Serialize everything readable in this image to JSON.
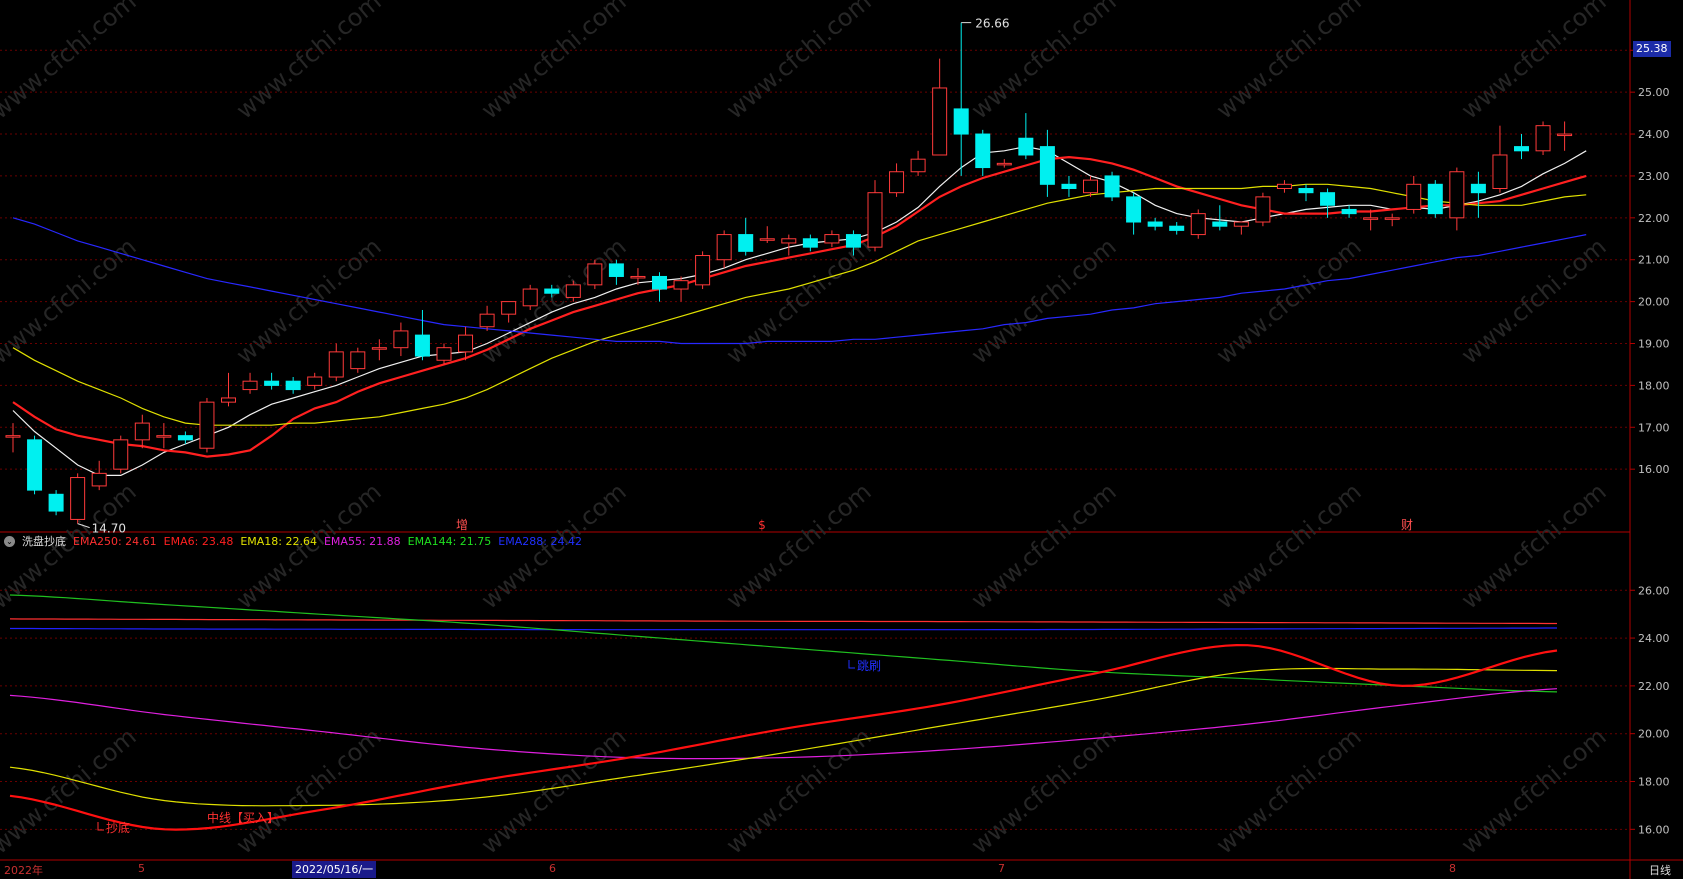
{
  "chart_data": [
    {
      "type": "candlestick",
      "ylim": [
        14.5,
        27.2
      ],
      "y_ticks": [
        "26.00",
        "25.00",
        "24.00",
        "23.00",
        "22.00",
        "21.00",
        "20.00",
        "19.00",
        "18.00",
        "17.00",
        "16.00"
      ],
      "last_price": "25.38",
      "high_annotation": "26.66",
      "low_annotation": "14.70",
      "candles": [
        {
          "o": 16.8,
          "c": 16.8,
          "h": 17.1,
          "l": 16.4
        },
        {
          "o": 16.7,
          "c": 15.5,
          "h": 16.8,
          "l": 15.4
        },
        {
          "o": 15.4,
          "c": 15.0,
          "h": 15.5,
          "l": 14.9
        },
        {
          "o": 14.8,
          "c": 15.8,
          "h": 15.9,
          "l": 14.7
        },
        {
          "o": 15.6,
          "c": 15.9,
          "h": 16.2,
          "l": 15.5
        },
        {
          "o": 16.0,
          "c": 16.7,
          "h": 16.8,
          "l": 15.9
        },
        {
          "o": 16.7,
          "c": 17.1,
          "h": 17.3,
          "l": 16.5
        },
        {
          "o": 16.8,
          "c": 16.8,
          "h": 17.1,
          "l": 16.5
        },
        {
          "o": 16.8,
          "c": 16.7,
          "h": 16.9,
          "l": 16.6
        },
        {
          "o": 16.5,
          "c": 17.6,
          "h": 17.7,
          "l": 16.4
        },
        {
          "o": 17.6,
          "c": 17.7,
          "h": 18.3,
          "l": 17.5
        },
        {
          "o": 17.9,
          "c": 18.1,
          "h": 18.3,
          "l": 17.8
        },
        {
          "o": 18.1,
          "c": 18.0,
          "h": 18.3,
          "l": 17.9
        },
        {
          "o": 18.1,
          "c": 17.9,
          "h": 18.2,
          "l": 17.8
        },
        {
          "o": 18.0,
          "c": 18.2,
          "h": 18.3,
          "l": 17.9
        },
        {
          "o": 18.2,
          "c": 18.8,
          "h": 19.0,
          "l": 18.1
        },
        {
          "o": 18.4,
          "c": 18.8,
          "h": 18.9,
          "l": 18.3
        },
        {
          "o": 18.9,
          "c": 18.9,
          "h": 19.1,
          "l": 18.6
        },
        {
          "o": 18.9,
          "c": 19.3,
          "h": 19.5,
          "l": 18.7
        },
        {
          "o": 19.2,
          "c": 18.7,
          "h": 19.8,
          "l": 18.6
        },
        {
          "o": 18.6,
          "c": 18.9,
          "h": 19.0,
          "l": 18.5
        },
        {
          "o": 18.8,
          "c": 19.2,
          "h": 19.4,
          "l": 18.6
        },
        {
          "o": 19.4,
          "c": 19.7,
          "h": 19.9,
          "l": 19.3
        },
        {
          "o": 19.7,
          "c": 20.0,
          "h": 20.0,
          "l": 19.5
        },
        {
          "o": 19.9,
          "c": 20.3,
          "h": 20.4,
          "l": 19.8
        },
        {
          "o": 20.3,
          "c": 20.2,
          "h": 20.4,
          "l": 20.1
        },
        {
          "o": 20.1,
          "c": 20.4,
          "h": 20.5,
          "l": 20.0
        },
        {
          "o": 20.4,
          "c": 20.9,
          "h": 21.0,
          "l": 20.3
        },
        {
          "o": 20.9,
          "c": 20.6,
          "h": 21.0,
          "l": 20.4
        },
        {
          "o": 20.6,
          "c": 20.6,
          "h": 20.8,
          "l": 20.4
        },
        {
          "o": 20.6,
          "c": 20.3,
          "h": 20.7,
          "l": 20.0
        },
        {
          "o": 20.3,
          "c": 20.5,
          "h": 20.6,
          "l": 20.0
        },
        {
          "o": 20.4,
          "c": 21.1,
          "h": 21.2,
          "l": 20.3
        },
        {
          "o": 21.0,
          "c": 21.6,
          "h": 21.7,
          "l": 20.8
        },
        {
          "o": 21.6,
          "c": 21.2,
          "h": 22.0,
          "l": 21.1
        },
        {
          "o": 21.5,
          "c": 21.5,
          "h": 21.8,
          "l": 21.4
        },
        {
          "o": 21.4,
          "c": 21.5,
          "h": 21.6,
          "l": 21.1
        },
        {
          "o": 21.5,
          "c": 21.3,
          "h": 21.6,
          "l": 21.2
        },
        {
          "o": 21.4,
          "c": 21.6,
          "h": 21.7,
          "l": 21.3
        },
        {
          "o": 21.6,
          "c": 21.3,
          "h": 21.7,
          "l": 21.1
        },
        {
          "o": 21.3,
          "c": 22.6,
          "h": 22.9,
          "l": 21.2
        },
        {
          "o": 22.6,
          "c": 23.1,
          "h": 23.3,
          "l": 22.5
        },
        {
          "o": 23.1,
          "c": 23.4,
          "h": 23.6,
          "l": 23.0
        },
        {
          "o": 23.5,
          "c": 25.1,
          "h": 25.8,
          "l": 23.5
        },
        {
          "o": 24.6,
          "c": 24.0,
          "h": 26.66,
          "l": 23.0
        },
        {
          "o": 24.0,
          "c": 23.2,
          "h": 24.1,
          "l": 23.0
        },
        {
          "o": 23.3,
          "c": 23.3,
          "h": 23.4,
          "l": 23.2
        },
        {
          "o": 23.9,
          "c": 23.5,
          "h": 24.5,
          "l": 23.4
        },
        {
          "o": 23.7,
          "c": 22.8,
          "h": 24.1,
          "l": 22.5
        },
        {
          "o": 22.8,
          "c": 22.7,
          "h": 23.0,
          "l": 22.5
        },
        {
          "o": 22.6,
          "c": 22.9,
          "h": 23.0,
          "l": 22.5
        },
        {
          "o": 23.0,
          "c": 22.5,
          "h": 23.1,
          "l": 22.4
        },
        {
          "o": 22.5,
          "c": 21.9,
          "h": 22.6,
          "l": 21.6
        },
        {
          "o": 21.9,
          "c": 21.8,
          "h": 22.0,
          "l": 21.7
        },
        {
          "o": 21.8,
          "c": 21.7,
          "h": 21.9,
          "l": 21.6
        },
        {
          "o": 21.6,
          "c": 22.1,
          "h": 22.2,
          "l": 21.5
        },
        {
          "o": 21.9,
          "c": 21.8,
          "h": 22.3,
          "l": 21.7
        },
        {
          "o": 21.8,
          "c": 21.9,
          "h": 21.9,
          "l": 21.6
        },
        {
          "o": 21.9,
          "c": 22.5,
          "h": 22.6,
          "l": 21.8
        },
        {
          "o": 22.7,
          "c": 22.8,
          "h": 22.9,
          "l": 22.6
        },
        {
          "o": 22.7,
          "c": 22.6,
          "h": 22.8,
          "l": 22.4
        },
        {
          "o": 22.6,
          "c": 22.3,
          "h": 22.7,
          "l": 22.0
        },
        {
          "o": 22.2,
          "c": 22.1,
          "h": 22.3,
          "l": 22.0
        },
        {
          "o": 22.0,
          "c": 22.0,
          "h": 22.2,
          "l": 21.7
        },
        {
          "o": 22.0,
          "c": 22.0,
          "h": 22.1,
          "l": 21.8
        },
        {
          "o": 22.2,
          "c": 22.8,
          "h": 23.0,
          "l": 22.1
        },
        {
          "o": 22.8,
          "c": 22.1,
          "h": 22.9,
          "l": 22.0
        },
        {
          "o": 22.0,
          "c": 23.1,
          "h": 23.2,
          "l": 21.7
        },
        {
          "o": 22.8,
          "c": 22.6,
          "h": 23.1,
          "l": 22.0
        },
        {
          "o": 22.7,
          "c": 23.5,
          "h": 24.2,
          "l": 22.6
        },
        {
          "o": 23.7,
          "c": 23.6,
          "h": 24.0,
          "l": 23.4
        },
        {
          "o": 23.6,
          "c": 24.2,
          "h": 24.3,
          "l": 23.5
        },
        {
          "o": 24.0,
          "c": 24.0,
          "h": 24.3,
          "l": 23.6
        }
      ],
      "lines": [
        {
          "color": "#f0f0f0",
          "values": [
            17.4,
            16.9,
            16.5,
            16.1,
            15.85,
            15.85,
            16.1,
            16.4,
            16.6,
            16.8,
            17.0,
            17.3,
            17.55,
            17.7,
            17.85,
            18.0,
            18.2,
            18.4,
            18.55,
            18.7,
            18.75,
            18.8,
            19.0,
            19.25,
            19.5,
            19.75,
            19.95,
            20.1,
            20.3,
            20.45,
            20.5,
            20.55,
            20.65,
            20.8,
            21.0,
            21.15,
            21.3,
            21.4,
            21.45,
            21.5,
            21.65,
            21.9,
            22.25,
            22.75,
            23.2,
            23.55,
            23.6,
            23.7,
            23.6,
            23.3,
            23.0,
            22.85,
            22.6,
            22.3,
            22.1,
            22.0,
            21.95,
            21.9,
            22.0,
            22.1,
            22.2,
            22.25,
            22.3,
            22.3,
            22.2,
            22.25,
            22.2,
            22.3,
            22.4,
            22.55,
            22.75,
            23.05,
            23.3,
            23.6
          ]
        },
        {
          "color": "#ff2020",
          "values": [
            17.6,
            17.25,
            16.95,
            16.8,
            16.7,
            16.6,
            16.55,
            16.45,
            16.4,
            16.3,
            16.35,
            16.45,
            16.8,
            17.2,
            17.45,
            17.6,
            17.85,
            18.05,
            18.2,
            18.35,
            18.5,
            18.65,
            18.85,
            19.1,
            19.35,
            19.55,
            19.75,
            19.9,
            20.05,
            20.2,
            20.3,
            20.4,
            20.55,
            20.7,
            20.85,
            20.95,
            21.05,
            21.15,
            21.25,
            21.35,
            21.55,
            21.8,
            22.15,
            22.5,
            22.75,
            22.95,
            23.1,
            23.25,
            23.4,
            23.45,
            23.4,
            23.3,
            23.15,
            22.95,
            22.75,
            22.6,
            22.45,
            22.3,
            22.2,
            22.1,
            22.1,
            22.1,
            22.15,
            22.15,
            22.2,
            22.25,
            22.3,
            22.3,
            22.35,
            22.4,
            22.55,
            22.7,
            22.85,
            23.0
          ]
        },
        {
          "color": "#e0e000",
          "values": [
            18.9,
            18.6,
            18.35,
            18.1,
            17.9,
            17.7,
            17.45,
            17.25,
            17.1,
            17.05,
            17.05,
            17.05,
            17.05,
            17.1,
            17.1,
            17.15,
            17.2,
            17.25,
            17.35,
            17.45,
            17.55,
            17.7,
            17.9,
            18.15,
            18.4,
            18.65,
            18.85,
            19.05,
            19.2,
            19.35,
            19.5,
            19.65,
            19.8,
            19.95,
            20.1,
            20.2,
            20.3,
            20.45,
            20.6,
            20.75,
            20.95,
            21.2,
            21.45,
            21.6,
            21.75,
            21.9,
            22.05,
            22.2,
            22.35,
            22.45,
            22.55,
            22.6,
            22.65,
            22.7,
            22.7,
            22.7,
            22.7,
            22.7,
            22.75,
            22.75,
            22.8,
            22.8,
            22.75,
            22.7,
            22.6,
            22.5,
            22.4,
            22.35,
            22.3,
            22.3,
            22.3,
            22.4,
            22.5,
            22.55
          ]
        },
        {
          "color": "#2828ff",
          "values": [
            22.0,
            21.85,
            21.65,
            21.45,
            21.3,
            21.15,
            21.0,
            20.85,
            20.7,
            20.55,
            20.45,
            20.35,
            20.25,
            20.15,
            20.05,
            19.95,
            19.85,
            19.75,
            19.65,
            19.55,
            19.45,
            19.4,
            19.35,
            19.3,
            19.25,
            19.2,
            19.15,
            19.1,
            19.05,
            19.05,
            19.05,
            19.0,
            19.0,
            19.0,
            19.0,
            19.05,
            19.05,
            19.05,
            19.05,
            19.1,
            19.1,
            19.15,
            19.2,
            19.25,
            19.3,
            19.35,
            19.45,
            19.5,
            19.6,
            19.65,
            19.7,
            19.8,
            19.85,
            19.95,
            20.0,
            20.05,
            20.1,
            20.2,
            20.25,
            20.3,
            20.4,
            20.5,
            20.55,
            20.65,
            20.75,
            20.85,
            20.95,
            21.05,
            21.1,
            21.2,
            21.3,
            21.4,
            21.5,
            21.6
          ]
        }
      ],
      "signal_labels": [
        "增",
        "$",
        "财"
      ]
    },
    {
      "type": "line",
      "ylim": [
        14.8,
        27.6
      ],
      "y_ticks": [
        "26.00",
        "24.00",
        "22.00",
        "20.00",
        "18.00",
        "16.00"
      ],
      "series": [
        {
          "name": "EMA250",
          "color": "#ff3030",
          "values": [
            24.8,
            24.78,
            24.76,
            24.74,
            24.72,
            24.7,
            24.69,
            24.67,
            24.65,
            24.63,
            24.61
          ]
        },
        {
          "name": "EMA288",
          "color": "#2020ff",
          "values": [
            24.4,
            24.38,
            24.37,
            24.36,
            24.35,
            24.35,
            24.35,
            24.36,
            24.38,
            24.4,
            24.42
          ]
        },
        {
          "name": "EMA144",
          "color": "#20c020",
          "values": [
            25.8,
            25.4,
            25.0,
            24.6,
            24.1,
            23.6,
            23.1,
            22.6,
            22.3,
            22.0,
            21.75
          ]
        },
        {
          "name": "EMA55",
          "color": "#e020e0",
          "values": [
            21.6,
            20.8,
            20.1,
            19.4,
            19.0,
            19.0,
            19.3,
            19.8,
            20.4,
            21.2,
            21.88
          ]
        },
        {
          "name": "EMA18",
          "color": "#e0e000",
          "values": [
            18.6,
            17.2,
            17.0,
            17.3,
            18.2,
            19.2,
            20.3,
            21.4,
            22.6,
            22.7,
            22.64
          ]
        },
        {
          "name": "EMA6",
          "color": "#ff1010",
          "values": [
            17.4,
            16.0,
            16.8,
            18.0,
            19.0,
            20.2,
            21.2,
            22.5,
            23.7,
            22.0,
            23.48
          ]
        }
      ],
      "annotations": [
        "抄底",
        "中线【买入】",
        "跳刷"
      ]
    }
  ],
  "indicator_bar": {
    "title": "洗盘抄底",
    "items": [
      {
        "label": "EMA250: 24.61",
        "color": "#ff3030"
      },
      {
        "label": "EMA6: 23.48",
        "color": "#ff2020"
      },
      {
        "label": "EMA18: 22.64",
        "color": "#e0e000"
      },
      {
        "label": "EMA55: 21.88",
        "color": "#e020e0"
      },
      {
        "label": "EMA144: 21.75",
        "color": "#20e020"
      },
      {
        "label": "EMA288: 24.42",
        "color": "#2030ff"
      }
    ]
  },
  "date_axis": {
    "labels": [
      "2022年",
      "5",
      "6",
      "7",
      "8"
    ],
    "cursor": "2022/05/16/一"
  },
  "period": "日线",
  "watermark": "www.cfchi.com"
}
